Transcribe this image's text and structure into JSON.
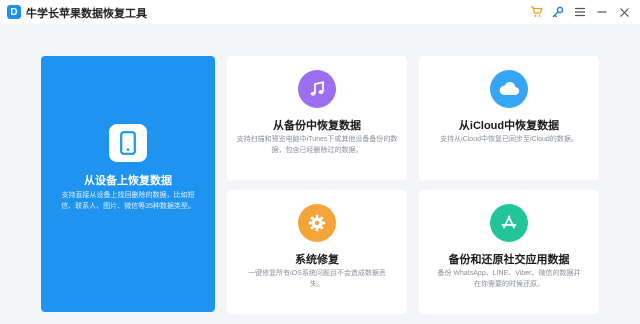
{
  "window": {
    "logo_letter": "D",
    "title": "牛学长苹果数据恢复工具"
  },
  "toolbar_icons": [
    "cart-icon",
    "key-icon",
    "menu-icon",
    "minimize-icon",
    "close-icon"
  ],
  "cards": [
    {
      "id": "device",
      "title": "从设备上恢复数据",
      "desc_lines": [
        "支持直接从设备上找回删除的数据，比如短",
        "信、联系人、图片、微信等35种数据类型。"
      ],
      "icon": "phone-icon",
      "selected": true
    },
    {
      "id": "itunes",
      "title": "从备份中恢复数据",
      "desc_lines": [
        "支持扫描和预览电脑中iTunes下或其他设备备份的数",
        "据，包含已经删除过的数据。"
      ],
      "icon": "music-note-icon",
      "icon_color": "#9b6ff0"
    },
    {
      "id": "icloud",
      "title": "从iCloud中恢复数据",
      "desc_lines": [
        "支持从iCloud中恢复已同步至iCloud的数据。"
      ],
      "icon": "cloud-icon",
      "icon_color": "#35a6f5"
    },
    {
      "id": "repair",
      "title": "系统修复",
      "desc_lines": [
        "一键修复所有iOS系统问题且不会造成数据丢",
        "失。"
      ],
      "icon": "gear-icon",
      "icon_color": "#f5a43a"
    },
    {
      "id": "social",
      "title": "备份和还原社交应用数据",
      "desc_lines": [
        "备份 WhatsApp、LINE、Viber、微信的数据并",
        "在你需要的时候还原。"
      ],
      "icon": "app-store-icon",
      "icon_color": "#22c49a"
    }
  ],
  "colors": {
    "primary": "#1e93ef",
    "background": "#f3f5f9"
  }
}
